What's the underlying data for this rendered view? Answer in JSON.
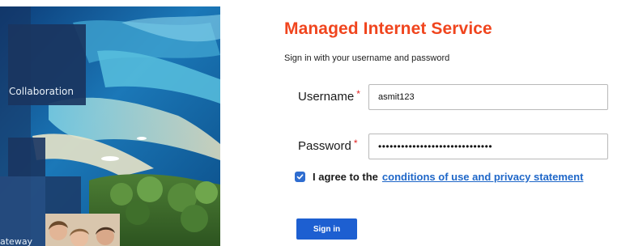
{
  "colors": {
    "accent": "#f0451e",
    "primary_button": "#1d5fd1",
    "link": "#1f67c8",
    "required": "#e02424"
  },
  "collage": {
    "label_collaboration": "Collaboration",
    "label_gateway": "ateway"
  },
  "page": {
    "title": "Managed Internet Service",
    "subtitle": "Sign in with your username and password"
  },
  "form": {
    "username_label": "Username",
    "username_value": "asmit123",
    "password_label": "Password",
    "password_value": "••••••••••••••••••••••••••••••",
    "required_marker": "*",
    "agree_checked": true,
    "agree_prefix": "I agree to the",
    "agree_link": "conditions of use and privacy statement",
    "signin_label": "Sign in"
  }
}
